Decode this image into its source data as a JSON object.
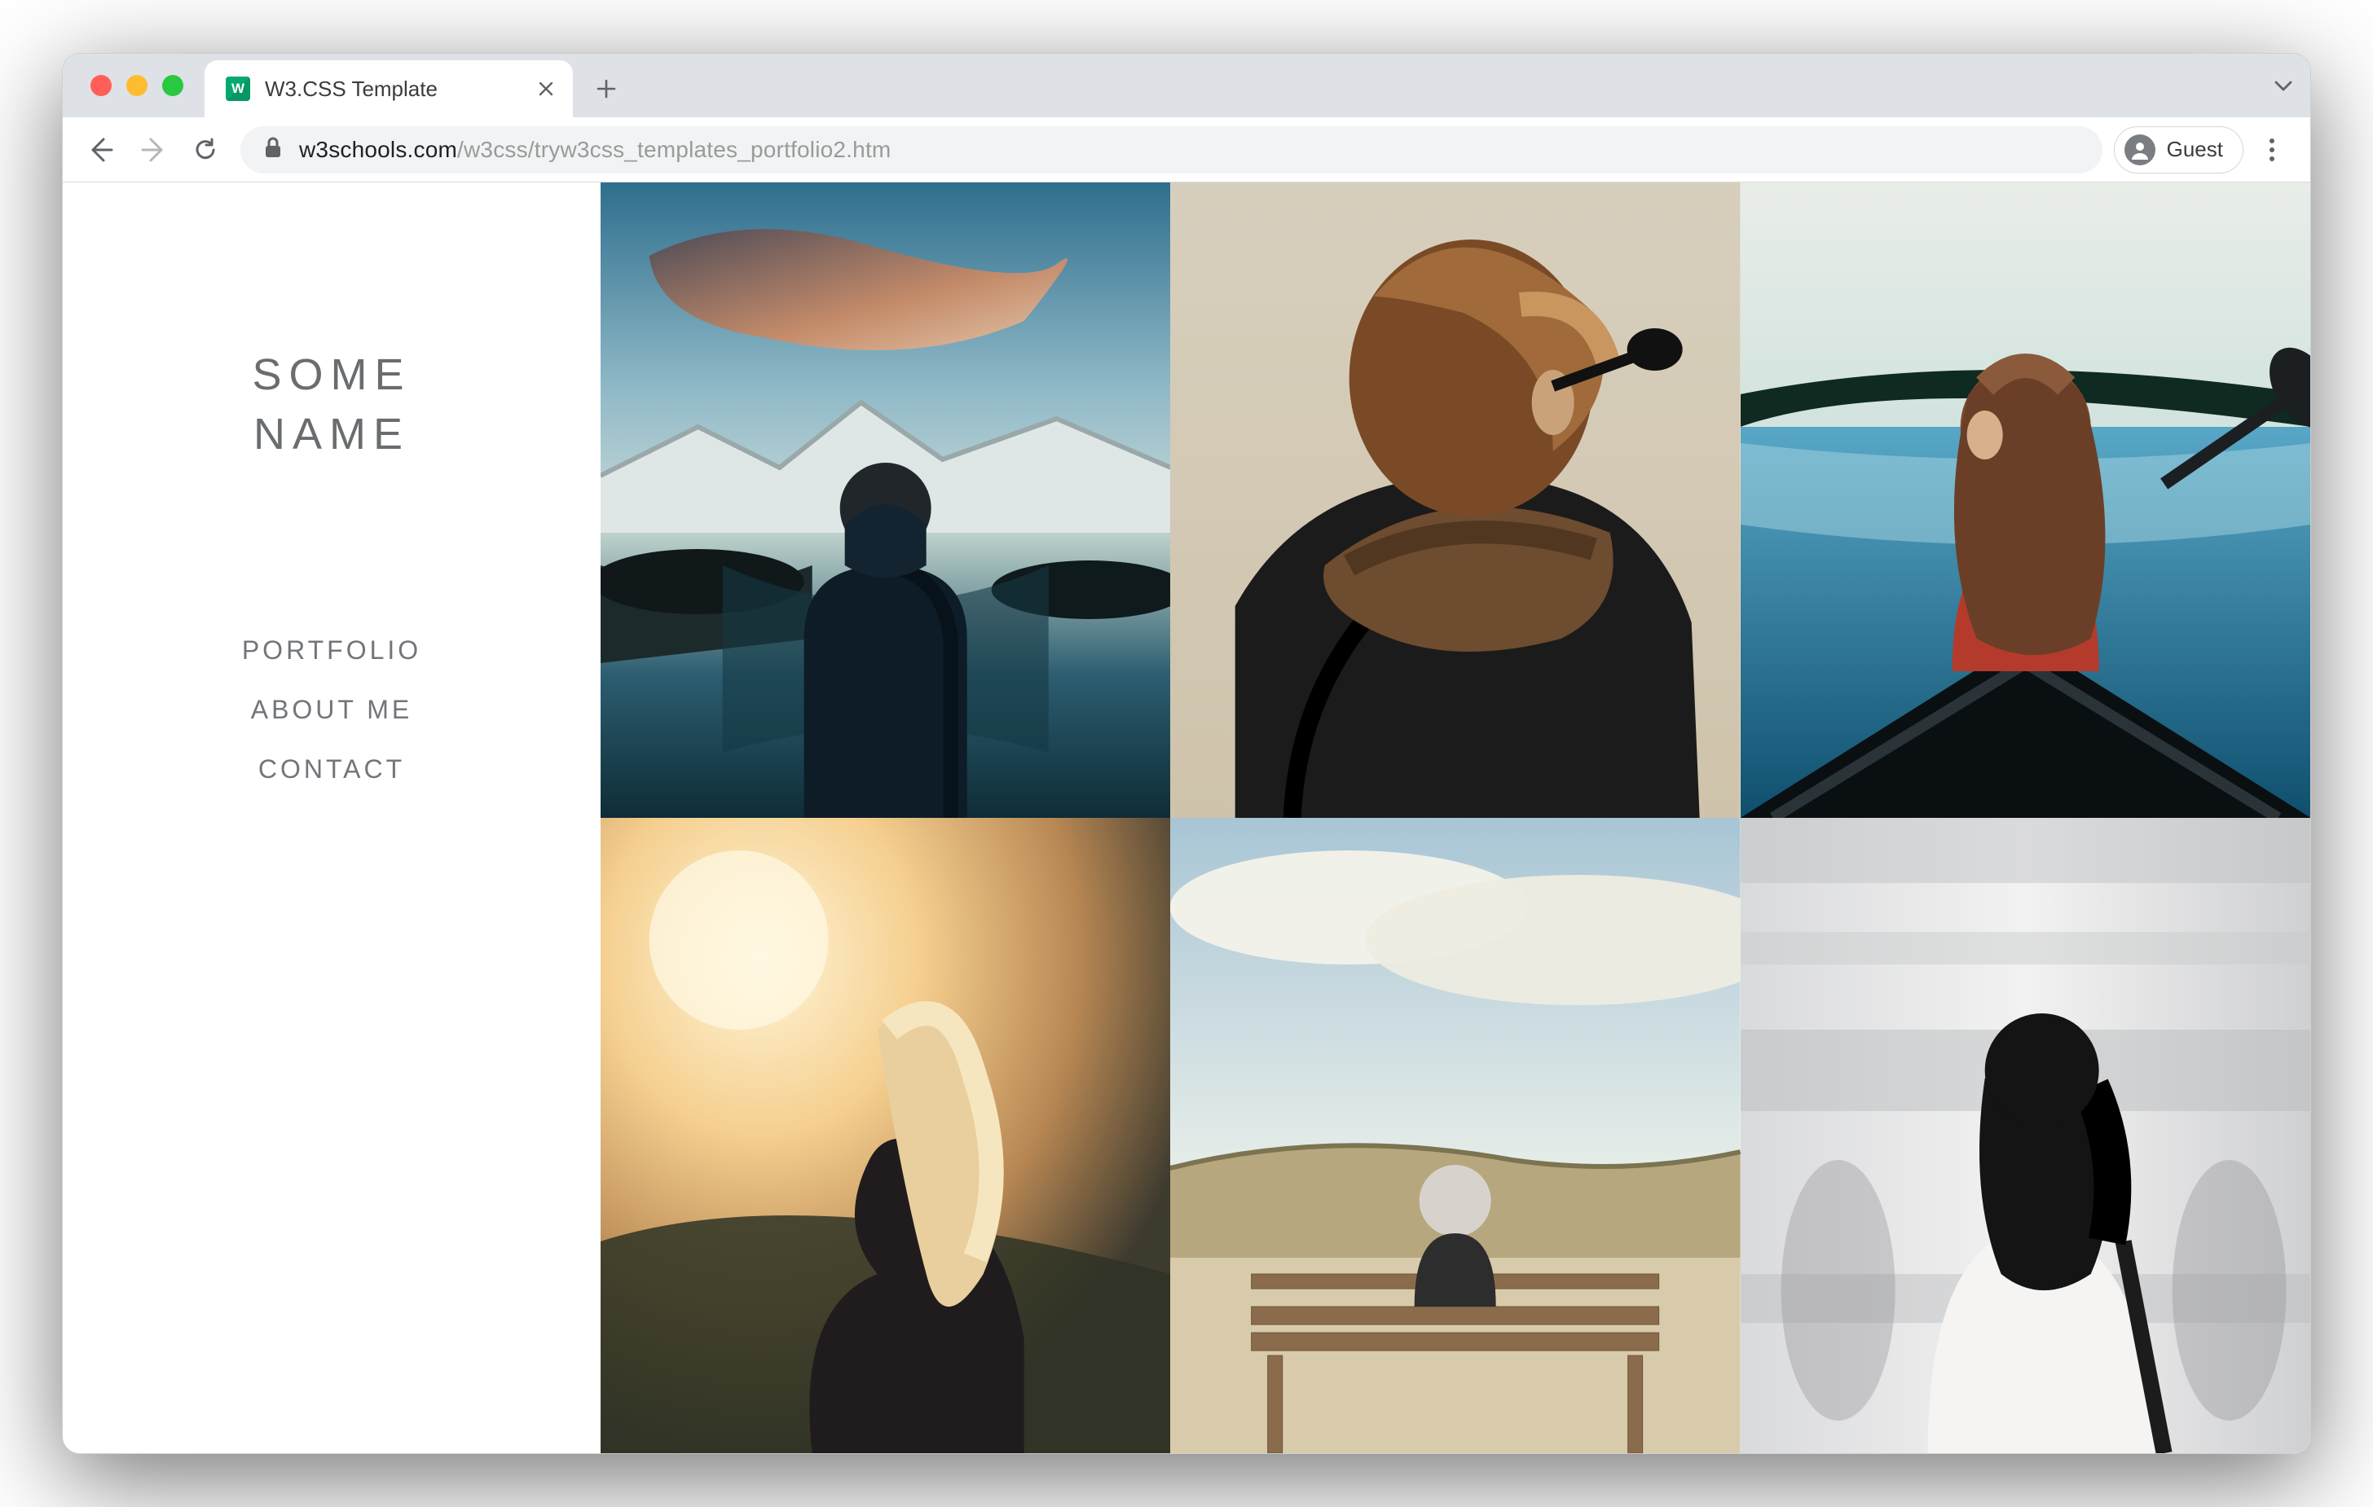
{
  "browser": {
    "tab_title": "W3.CSS Template",
    "url_host": "w3schools.com",
    "url_path": "/w3css/tryw3css_templates_portfolio2.htm",
    "guest_label": "Guest"
  },
  "sidebar": {
    "title_line1": "SOME",
    "title_line2": "NAME",
    "nav": {
      "portfolio": "PORTFOLIO",
      "about": "ABOUT ME",
      "contact": "CONTACT"
    }
  },
  "gallery": {
    "items": [
      {
        "name": "man-lake-mountains"
      },
      {
        "name": "woman-scarf-sunglasses"
      },
      {
        "name": "woman-canoe-lake"
      },
      {
        "name": "woman-sunset-lensflare"
      },
      {
        "name": "person-bench-dunes"
      },
      {
        "name": "woman-subway-blur"
      }
    ]
  }
}
